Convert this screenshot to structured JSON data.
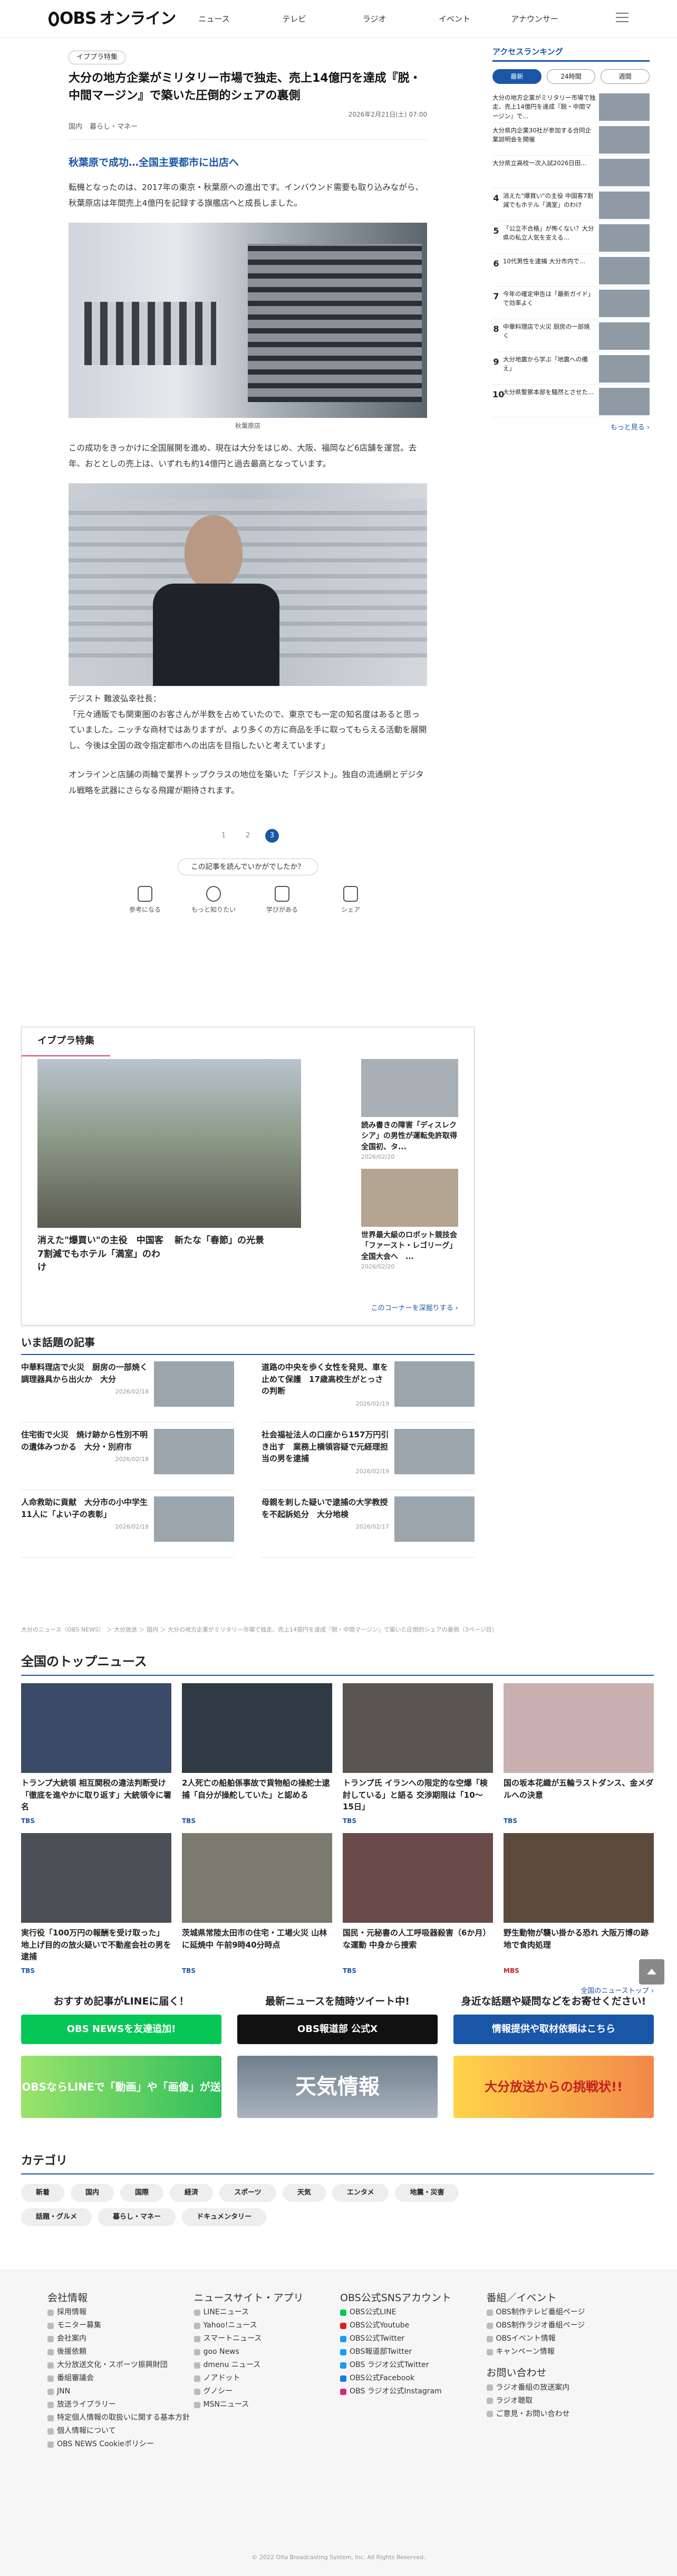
{
  "header": {
    "logo": "OBS",
    "logo_sub": "オンライン",
    "nav": [
      "ニュース",
      "テレビ",
      "ラジオ",
      "イベント",
      "アナウンサー"
    ]
  },
  "article": {
    "badge": "イブプラ特集",
    "title": "大分の地方企業がミリタリー市場で独走、売上14億円を達成『脱・中間マージン』で築いた圧倒的シェアの裏側",
    "date": "2026年2月21日(土) 07:00",
    "categories": [
      "国内",
      "暮らし・マネー"
    ],
    "lead": "秋葉原で成功…全国主要都市に出店へ",
    "p1": "転機となったのは、2017年の東京・秋葉原への進出です。インバウンド需要も取り込みながら、秋葉原店は年間売上4億円を記録する旗艦店へと成長しました。",
    "photo1_caption": "秋葉原店",
    "p2": "この成功をきっかけに全国展開を進め、現在は大分をはじめ、大阪、福岡など6店舗を運営。去年、おととしの売上は、いずれも約14億円と過去最高となっています。",
    "p3": "デジスト 難波弘幸社長：\n「元々通販でも関東圏のお客さんが半数を占めていたので、東京でも一定の知名度はあると思っていました。ニッチな商材ではありますが、より多くの方に商品を手に取ってもらえる活動を展開し、今後は全国の政令指定都市への出店を目指したいと考えています」",
    "p4": "オンラインと店舗の両輪で業界トップクラスの地位を築いた「デジスト」。独自の流通網とデジタル戦略を武器にさらなる飛躍が期待されます。",
    "pager": [
      "1",
      "2",
      "3"
    ],
    "reaction_q": "この記事を読んでいかがでしたか？",
    "reactions": [
      "参考になる",
      "もっと知りたい",
      "学びがある",
      "シェア"
    ]
  },
  "ranking": {
    "title": "アクセスランキング",
    "tabs": [
      "最新",
      "24時間",
      "週間"
    ],
    "items": [
      {
        "n": "1",
        "t": "大分の地方企業がミリタリー市場で独走、売上14億円を達成『脱・中間マージン』で..."
      },
      {
        "n": "2",
        "t": "大分県内企業30社が参加する合同企業説明会を開催"
      },
      {
        "n": "3",
        "t": "大分県立高校一次入試2026日田..."
      },
      {
        "n": "4",
        "t": "消えた\"爆買い\"の主役 中国客7割減でもホテル「満室」のわけ"
      },
      {
        "n": "5",
        "t": "「公立不合格」が怖くない？大分県の私立人気を支える..."
      },
      {
        "n": "6",
        "t": "10代男性を逮捕 大分市内で..."
      },
      {
        "n": "7",
        "t": "今年の確定申告は「最新ガイド」で効率よく"
      },
      {
        "n": "8",
        "t": "中華料理店で火災 厨房の一部焼く"
      },
      {
        "n": "9",
        "t": "大分地震から学ぶ「地震への備え」"
      },
      {
        "n": "10",
        "t": "大分県警察本部を騒然とさせた..."
      }
    ],
    "more": "もっと見る ›"
  },
  "feature": {
    "title": "イブプラ特集",
    "big_left": "消えた\"爆買い\"の主役　中国客7割減でもホテル「満室」のわけ",
    "big_right": "新たな「春節」の光景",
    "right": [
      {
        "t": "読み書きの障害「ディスレクシア」の男性が運転免許取得　全国初、タ...",
        "d": "2026/02/20"
      },
      {
        "t": "世界最大級のロボット競技会「ファースト・レゴリーグ」全国大会へ　...",
        "d": "2026/02/20"
      }
    ],
    "more": "このコーナーを深掘りする ›"
  },
  "hot": {
    "title": "いま話題の記事",
    "items": [
      {
        "t": "中華料理店で火災　厨房の一部焼く　調理器具から出火か　大分",
        "d": "2026/02/18"
      },
      {
        "t": "道路の中央を歩く女性を発見、車を止めて保護　17歳高校生がとっさの判断",
        "d": "2026/02/19"
      },
      {
        "t": "住宅街で火災　焼け跡から性別不明の遺体みつかる　大分・別府市",
        "d": "2026/02/18"
      },
      {
        "t": "社会福祉法人の口座から157万円引き出す　業務上横領容疑で元経理担当の男を逮捕",
        "d": "2026/02/19"
      },
      {
        "t": "人命救助に貢献　大分市の小中学生11人に「よい子の表彰」",
        "d": "2026/02/18"
      },
      {
        "t": "母親を刺した疑いで逮捕の大学教授を不起訴処分　大分地検",
        "d": "2026/02/17"
      }
    ]
  },
  "breadcrumb": "大分のニュース（OBS NEWS） ＞ 大分放送 ＞ 国内 ＞ 大分の地方企業がミリタリー市場で独走、売上14億円を達成『脱・中間マージン』で築いた圧倒的シェアの裏側（3ページ目）",
  "top": {
    "title": "全国のトップニュース",
    "items": [
      {
        "t": "トランプ大統領 相互関税の違法判断受け「徹底を進やかに取り返す」大統領令に署名",
        "s": "TBS"
      },
      {
        "t": "2人死亡の船舶係事故で貨物船の操舵士逮捕「自分が操舵していた」と認める",
        "s": "TBS"
      },
      {
        "t": "トランプ氏 イランへの限定的な空爆「検討している」と語る 交渉期限は「10～15日」",
        "s": "TBS"
      },
      {
        "t": "国の坂本花織が五輪ラストダンス、金メダルへの決意",
        "s": "TBS"
      },
      {
        "t": "実行役「100万円の報酬を受け取った」 地上げ目的の放火疑いで不動産会社の男を逮捕",
        "s": "TBS"
      },
      {
        "t": "茨城県常陸太田市の住宅・工場火災 山林に延焼中 午前9時40分時点",
        "s": "TBS"
      },
      {
        "t": "国民・元秘書の人工呼吸器殺害（6か月）な運動 中身から捜索",
        "s": "TBS"
      },
      {
        "t": "野生動物が襲い掛かる恐れ 大阪万博の跡地で食肉処理",
        "s": "MBS"
      }
    ],
    "more": "全国のニューストップ ›"
  },
  "promos": [
    {
      "h": "おすすめ記事がLINEに届く！",
      "b": "OBS NEWSを友達追加!",
      "c": "#06c755"
    },
    {
      "h": "最新ニュースを随時ツイート中!",
      "b": "OBS報道部 公式X",
      "c": "#111111"
    },
    {
      "h": "身近な話題や疑問などをお寄せください!",
      "b": "情報提供や取材依頼はこちら",
      "c": "#1a56a8"
    }
  ],
  "banners": [
    "OBSならLINEで「動画」や「画像」が送れる!",
    "天気情報",
    "大分放送からの挑戦状!!"
  ],
  "category": {
    "title": "カテゴリ",
    "chips": [
      "新着",
      "国内",
      "国際",
      "経済",
      "スポーツ",
      "天気",
      "エンタメ",
      "地震・災害",
      "話題・グルメ",
      "暮らし・マネー",
      "ドキュメンタリー"
    ]
  },
  "footer": {
    "cols": [
      {
        "h": "会社情報",
        "items": [
          "採用情報",
          "モニター募集",
          "会社案内",
          "後援依頼",
          "大分放送文化・スポーツ振興財団",
          "番組審議会",
          "JNN",
          "放送ライブラリー",
          "特定個人情報の取扱いに関する基本方針",
          "個人情報について",
          "OBS NEWS Cookieポリシー"
        ]
      },
      {
        "h": "ニュースサイト・アプリ",
        "items": [
          "LINEニュース",
          "Yahoo!ニュース",
          "スマートニュース",
          "goo News",
          "dmenu ニュース",
          "ノアドット",
          "グノシー",
          "MSNニュース"
        ]
      },
      {
        "h": "OBS公式SNSアカウント",
        "items": [
          "OBS公式LINE",
          "OBS公式Youtube",
          "OBS公式Twitter",
          "OBS報道部Twitter",
          "OBS ラジオ公式Twitter",
          "OBS公式Facebook",
          "OBS ラジオ公式Instagram"
        ]
      },
      {
        "h": "番組／イベント",
        "items": [
          "OBS制作テレビ番組ページ",
          "OBS制作ラジオ番組ページ",
          "OBSイベント情報",
          "キャンペーン情報"
        ]
      }
    ],
    "inquiry_title": "お問い合わせ",
    "inquiry": [
      "ラジオ番組の放送案内",
      "ラジオ聴取",
      "ご意見・お問い合わせ"
    ],
    "copyright": "© 2022 Oita Broadcasting System, Inc. All Rights Reserved."
  }
}
